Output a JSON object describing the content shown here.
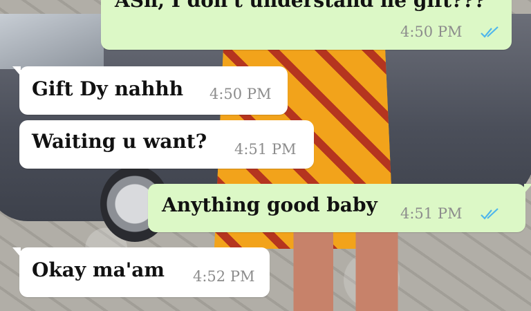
{
  "conversation": {
    "messages": [
      {
        "direction": "outgoing",
        "text": "ASh, I don't understand ne gift???",
        "time": "4:50 PM",
        "status": "read"
      },
      {
        "direction": "incoming",
        "text": "Gift Dy nahhh",
        "time": "4:50 PM"
      },
      {
        "direction": "incoming",
        "text": "Waiting u want?",
        "time": "4:51 PM"
      },
      {
        "direction": "outgoing",
        "text": "Anything good baby",
        "time": "4:51 PM",
        "status": "read"
      },
      {
        "direction": "incoming",
        "text": "Okay ma'am",
        "time": "4:52 PM"
      }
    ]
  },
  "colors": {
    "incoming_bubble": "#ffffff",
    "outgoing_bubble": "#dcf8c6",
    "read_ticks": "#4fb6ec",
    "timestamp": "#8c8c8c"
  },
  "icons": {
    "read_receipt": "double-check-icon"
  }
}
